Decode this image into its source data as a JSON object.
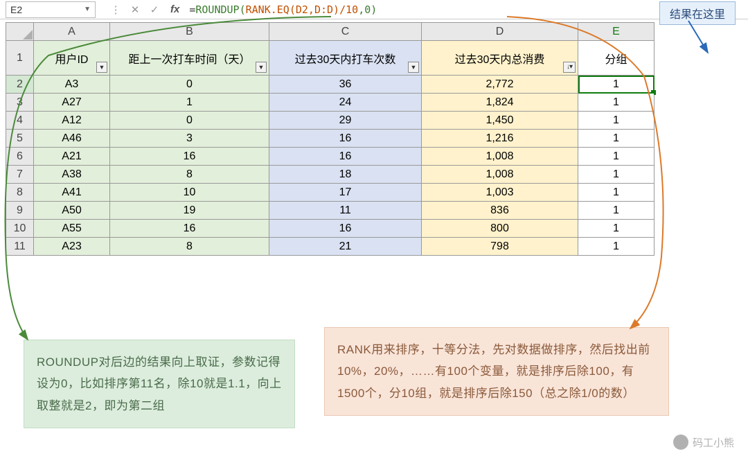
{
  "formula_bar": {
    "cell_ref": "E2",
    "fx_label": "fx",
    "formula_html": "=<span class='fn1'>ROUNDUP(</span><span class='fn2'>RANK.EQ(D2,D:D)/10</span><span class='fn1'>,0)</span>"
  },
  "result_badge": "结果在这里",
  "columns": [
    "A",
    "B",
    "C",
    "D",
    "E"
  ],
  "headers": {
    "A": "用户ID",
    "B": "距上一次打车时间（天）",
    "C": "过去30天内打车次数",
    "D": "过去30天内总消费",
    "E": "分组"
  },
  "rows": [
    {
      "n": 1,
      "A": "用户ID",
      "B": "距上一次打车时间（天）",
      "C": "过去30天内打车次数",
      "D": "过去30天内总消费",
      "E": "分组"
    },
    {
      "n": 2,
      "A": "A3",
      "B": "0",
      "C": "36",
      "D": "2,772",
      "E": "1"
    },
    {
      "n": 3,
      "A": "A27",
      "B": "1",
      "C": "24",
      "D": "1,824",
      "E": "1"
    },
    {
      "n": 4,
      "A": "A12",
      "B": "0",
      "C": "29",
      "D": "1,450",
      "E": "1"
    },
    {
      "n": 5,
      "A": "A46",
      "B": "3",
      "C": "16",
      "D": "1,216",
      "E": "1"
    },
    {
      "n": 6,
      "A": "A21",
      "B": "16",
      "C": "16",
      "D": "1,008",
      "E": "1"
    },
    {
      "n": 7,
      "A": "A38",
      "B": "8",
      "C": "18",
      "D": "1,008",
      "E": "1"
    },
    {
      "n": 8,
      "A": "A41",
      "B": "10",
      "C": "17",
      "D": "1,003",
      "E": "1"
    },
    {
      "n": 9,
      "A": "A50",
      "B": "19",
      "C": "11",
      "D": "836",
      "E": "1"
    },
    {
      "n": 10,
      "A": "A55",
      "B": "16",
      "C": "16",
      "D": "800",
      "E": "1"
    },
    {
      "n": 11,
      "A": "A23",
      "B": "8",
      "C": "21",
      "D": "798",
      "E": "1"
    }
  ],
  "annotations": {
    "green": "ROUNDUP对后边的结果向上取证，参数记得设为0，比如排序第11名，除10就是1.1，向上取整就是2，即为第二组",
    "orange": "RANK用来排序，十等分法，先对数据做排序，然后找出前10%，20%，……有100个变量，就是排序后除100，有1500个，分10组，就是排序后除150（总之除1/0的数）"
  },
  "watermark": "码工小熊"
}
